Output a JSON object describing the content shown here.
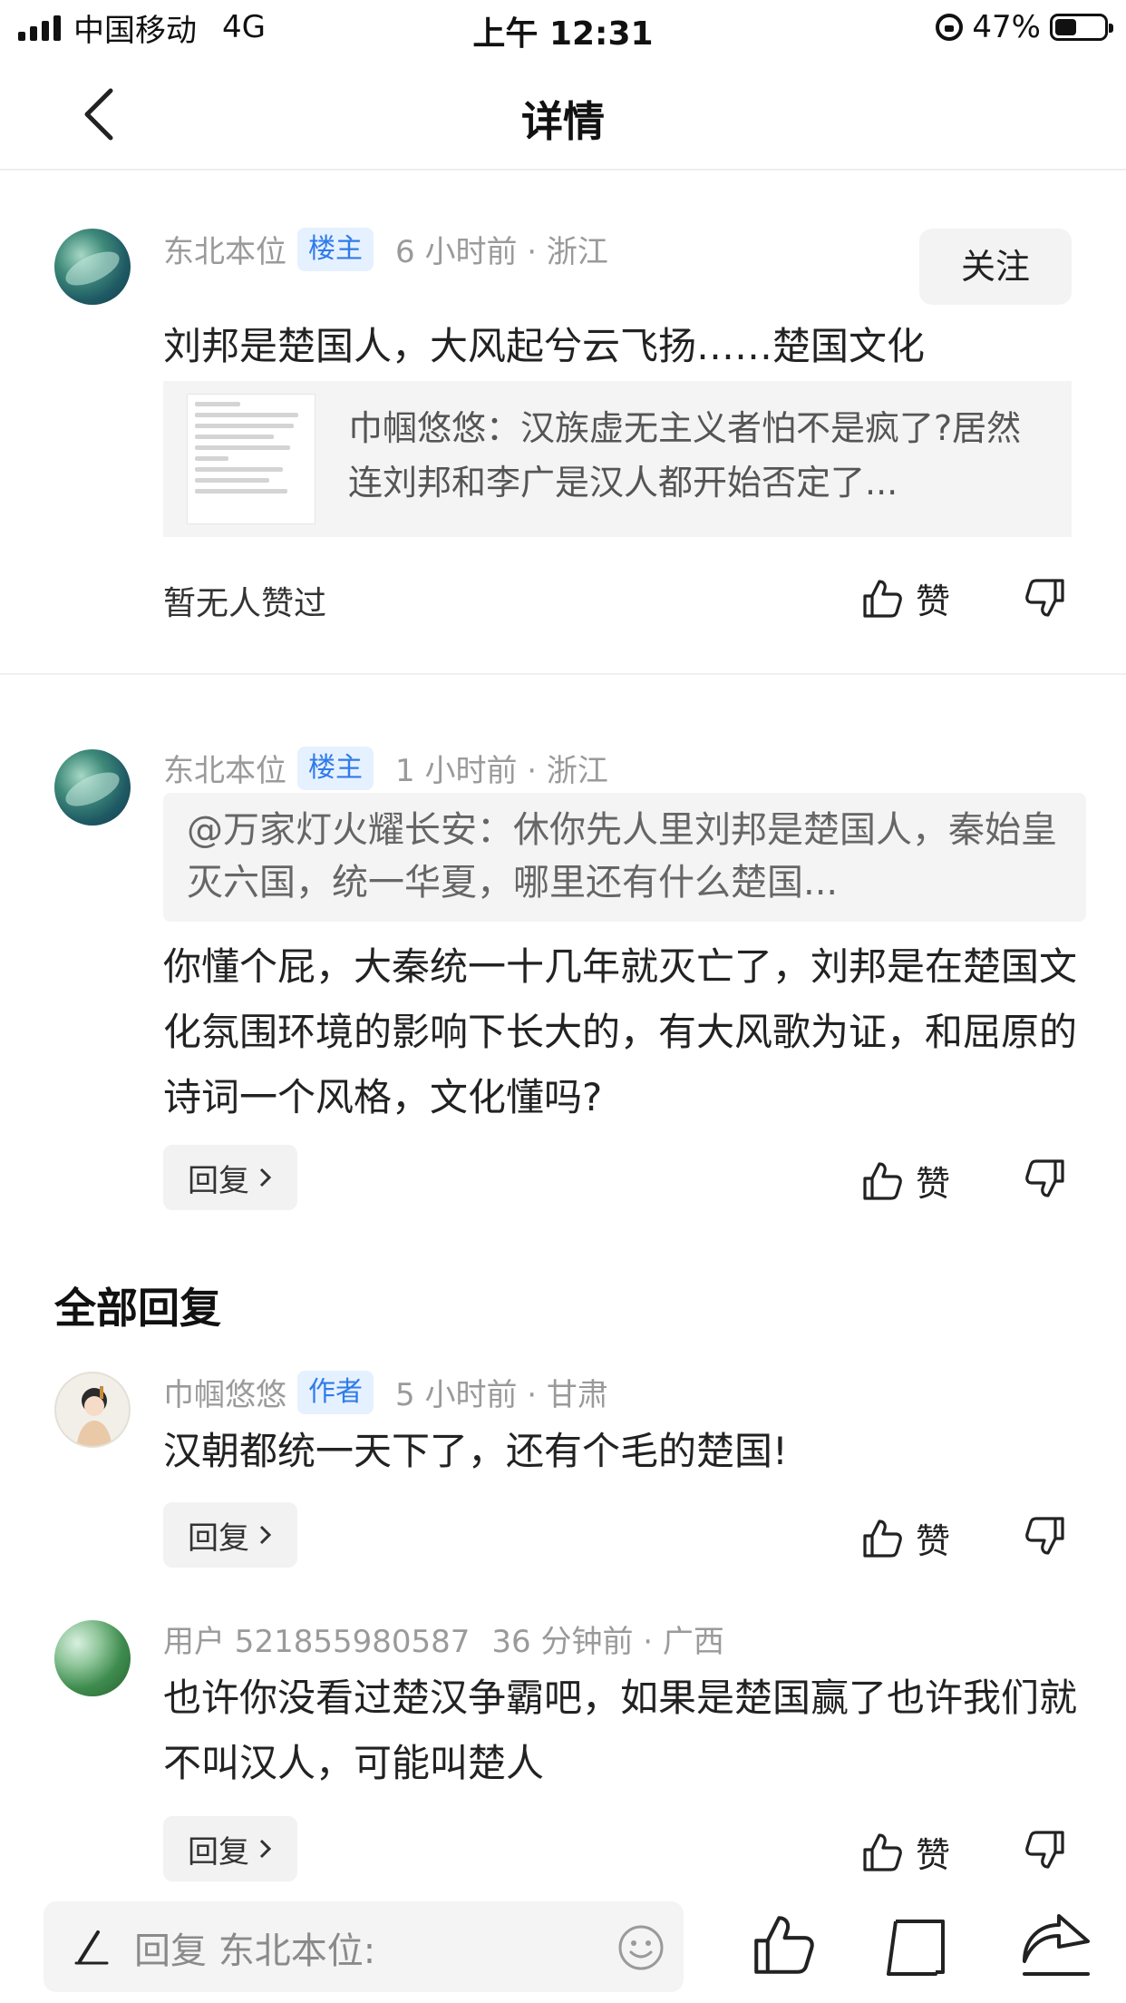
{
  "status_bar": {
    "carrier": "中国移动",
    "network": "4G",
    "time": "上午 12:31",
    "battery": "47%"
  },
  "nav": {
    "title": "详情"
  },
  "main_comment": {
    "author": "东北本位",
    "badge": "楼主",
    "time_location": "6 小时前 · 浙江",
    "follow_label": "关注",
    "text": "刘邦是楚国人，大风起兮云飞扬……楚国文化",
    "share_text": "巾帼悠悠：汉族虚无主义者怕不是疯了?居然连刘邦和李广是汉人都开始否定了...",
    "like_status": "暂无人赞过",
    "like_label": "赞"
  },
  "reply_comment": {
    "author": "东北本位",
    "badge": "楼主",
    "time_location": "1 小时前 · 浙江",
    "quote": "@万家灯火耀长安：休你先人里刘邦是楚国人，秦始皇灭六国，统一华夏，哪里还有什么楚国...",
    "text": "你懂个屁，大秦统一十几年就灭亡了，刘邦是在楚国文化氛围环境的影响下长大的，有大风歌为证，和屈原的诗词一个风格，文化懂吗?",
    "reply_label": "回复",
    "like_label": "赞"
  },
  "all_replies": {
    "title": "全部回复",
    "items": [
      {
        "author": "巾帼悠悠",
        "badge": "作者",
        "time_location": "5 小时前 · 甘肃",
        "text": "汉朝都统一天下了，还有个毛的楚国!",
        "reply_label": "回复",
        "like_label": "赞"
      },
      {
        "author": "用户 521855980587",
        "badge": "",
        "time_location": "36 分钟前 · 广西",
        "text": "也许你没看过楚汉争霸吧，如果是楚国赢了也许我们就不叫汉人，可能叫楚人",
        "reply_label": "回复",
        "like_label": "赞"
      }
    ]
  },
  "bottom_bar": {
    "placeholder": "回复 东北本位:"
  },
  "colors": {
    "badge_blue": "#2f7bea",
    "badge_bg": "#e6f1ff",
    "muted": "#9a9a9a"
  }
}
